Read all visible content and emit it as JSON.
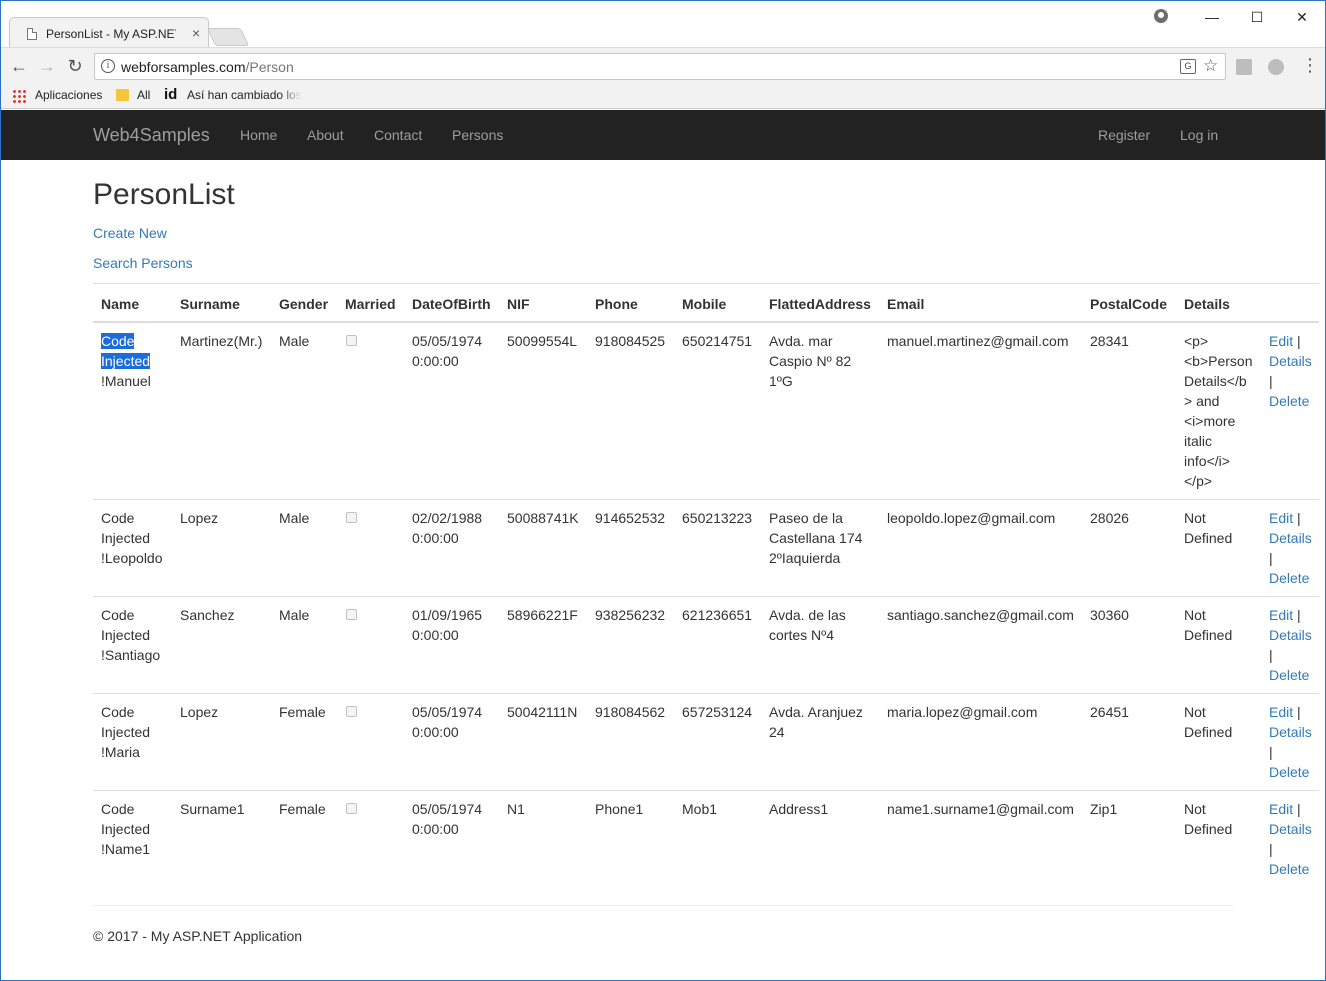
{
  "browser": {
    "tab_title": "PersonList - My ASP.NET",
    "tab_close": "×",
    "window_controls": {
      "minimize": "—",
      "maximize": "☐",
      "close": "✕"
    },
    "url_host": "webforsamples.com",
    "url_path": "/Person",
    "bookmarks": {
      "apps": "Aplicaciones",
      "all": "All",
      "article": "Así han cambiado los"
    }
  },
  "nav": {
    "brand": "Web4Samples",
    "links": [
      "Home",
      "About",
      "Contact",
      "Persons"
    ],
    "register": "Register",
    "login": "Log in"
  },
  "page": {
    "title": "PersonList",
    "create_new": "Create New",
    "search_persons": "Search Persons"
  },
  "table": {
    "headers": [
      "Name",
      "Surname",
      "Gender",
      "Married",
      "DateOfBirth",
      "NIF",
      "Phone",
      "Mobile",
      "FlattedAddress",
      "Email",
      "PostalCode",
      "Details"
    ],
    "action_labels": {
      "edit": "Edit",
      "details": "Details",
      "delete": "Delete",
      "separator": "|"
    },
    "rows": [
      {
        "name_prefix": "Code Injected",
        "name_suffix": "!Manuel",
        "surname": "Martinez(Mr.)",
        "gender": "Male",
        "married": false,
        "dob_date": "05/05/1974",
        "dob_time": "0:00:00",
        "nif": "50099554L",
        "phone": "918084525",
        "mobile": "650214751",
        "address": "Avda. mar Caspio Nº 82 1ºG",
        "email": "manuel.martinez@gmail.com",
        "postal": "28341",
        "details": "<p><b>Person Details</b> and <i>more italic info</i></p>"
      },
      {
        "name_prefix": "Code Injected",
        "name_suffix": "!Leopoldo",
        "surname": "Lopez",
        "gender": "Male",
        "married": false,
        "dob_date": "02/02/1988",
        "dob_time": "0:00:00",
        "nif": "50088741K",
        "phone": "914652532",
        "mobile": "650213223",
        "address": "Paseo de la Castellana 174 2ºIaquierda",
        "email": "leopoldo.lopez@gmail.com",
        "postal": "28026",
        "details": "Not Defined"
      },
      {
        "name_prefix": "Code Injected",
        "name_suffix": "!Santiago",
        "surname": "Sanchez",
        "gender": "Male",
        "married": false,
        "dob_date": "01/09/1965",
        "dob_time": "0:00:00",
        "nif": "58966221F",
        "phone": "938256232",
        "mobile": "621236651",
        "address": "Avda. de las cortes Nº4",
        "email": "santiago.sanchez@gmail.com",
        "postal": "30360",
        "details": "Not Defined"
      },
      {
        "name_prefix": "Code Injected",
        "name_suffix": "!Maria",
        "surname": "Lopez",
        "gender": "Female",
        "married": false,
        "dob_date": "05/05/1974",
        "dob_time": "0:00:00",
        "nif": "50042111N",
        "phone": "918084562",
        "mobile": "657253124",
        "address": "Avda. Aranjuez 24",
        "email": "maria.lopez@gmail.com",
        "postal": "26451",
        "details": "Not Defined"
      },
      {
        "name_prefix": "Code Injected",
        "name_suffix": "!Name1",
        "surname": "Surname1",
        "gender": "Female",
        "married": false,
        "dob_date": "05/05/1974",
        "dob_time": "0:00:00",
        "nif": "N1",
        "phone": "Phone1",
        "mobile": "Mob1",
        "address": "Address1",
        "email": "name1.surname1@gmail.com",
        "postal": "Zip1",
        "details": "Not Defined"
      }
    ]
  },
  "footer": {
    "text": "© 2017 - My ASP.NET Application"
  }
}
